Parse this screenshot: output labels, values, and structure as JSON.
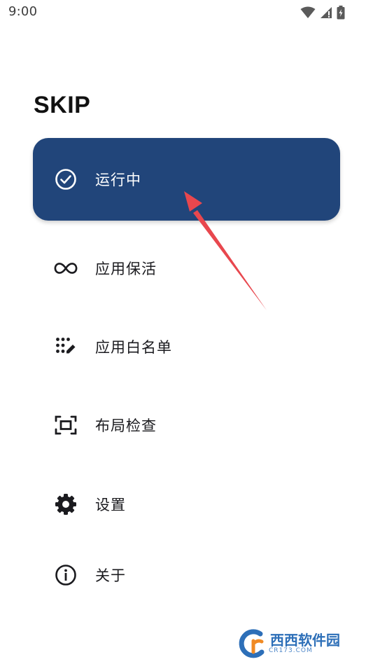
{
  "status_bar": {
    "time": "9:00",
    "icons": [
      "wifi-icon",
      "signal-icon",
      "battery-icon"
    ]
  },
  "app": {
    "title": "SKIP"
  },
  "menu": {
    "items": [
      {
        "label": "运行中",
        "icon": "check-circle-icon",
        "active": true
      },
      {
        "label": "应用保活",
        "icon": "infinity-icon",
        "active": false
      },
      {
        "label": "应用白名单",
        "icon": "dots-edit-icon",
        "active": false
      },
      {
        "label": "布局检查",
        "icon": "frame-scan-icon",
        "active": false
      },
      {
        "label": "设置",
        "icon": "gear-icon",
        "active": false
      },
      {
        "label": "关于",
        "icon": "info-icon",
        "active": false
      }
    ]
  },
  "colors": {
    "active_background": "#21457a",
    "active_text": "#ffffff",
    "text": "#1b1b1f",
    "annotation_arrow": "#e8474e"
  },
  "watermark": {
    "text": "西西软件园",
    "subtext": "CR173.COM"
  }
}
